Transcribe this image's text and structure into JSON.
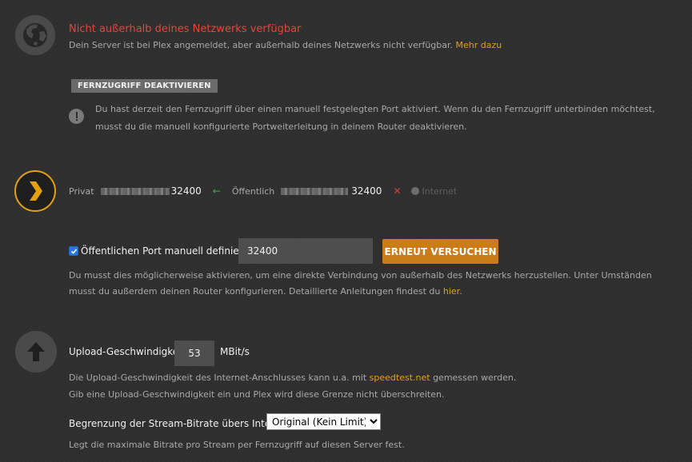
{
  "remote": {
    "title": "Nicht außerhalb deines Netzwerks verfügbar",
    "subtitle": "Dein Server ist bei Plex angemeldet, aber außerhalb deines Netzwerks nicht verfügbar.",
    "more_link": "Mehr dazu",
    "disable_button": "FERNZUGRIFF DEAKTIVIEREN",
    "info_text": "Du hast derzeit den Fernzugriff über einen manuell festgelegten Port aktiviert. Wenn du den Fernzugriff unterbinden möchtest, musst du die manuell konfigurierte Portweiterleitung in deinem Router deaktivieren."
  },
  "ports": {
    "private_label": "Privat",
    "private_port": "32400",
    "public_label": "Öffentlich",
    "public_port": "32400",
    "internet_label": "Internet"
  },
  "manual_port": {
    "checkbox_label": "Öffentlichen Port manuell definieren",
    "checked": true,
    "port_value": "32400",
    "retry_button": "ERNEUT VERSUCHEN",
    "help_text": "Du musst dies möglicherweise aktivieren, um eine direkte Verbindung von außerhalb des Netzwerks herzustellen. Unter Umständen musst du außerdem deinen Router konfigurieren. Detaillierte Anleitungen findest du",
    "help_link": "hier"
  },
  "upload": {
    "label": "Upload-Geschwindigkeit",
    "value": "53",
    "unit": "MBit/s",
    "desc_prefix": "Die Upload-Geschwindigkeit des Internet-Anschlusses kann u.a. mit",
    "desc_link": "speedtest.net",
    "desc_suffix": "gemessen werden.",
    "desc_line2": "Gib eine Upload-Geschwindigkeit ein und Plex wird diese Grenze nicht überschreiten."
  },
  "bitrate": {
    "label": "Begrenzung der Stream-Bitrate übers Internet",
    "selected": "Original (Kein Limit)",
    "desc": "Legt die maximale Bitrate pro Stream per Fernzugriff auf diesen Server fest."
  },
  "colors": {
    "warning": "#e5453a",
    "accent": "#e5a00d",
    "button_orange": "#cc7b19"
  }
}
